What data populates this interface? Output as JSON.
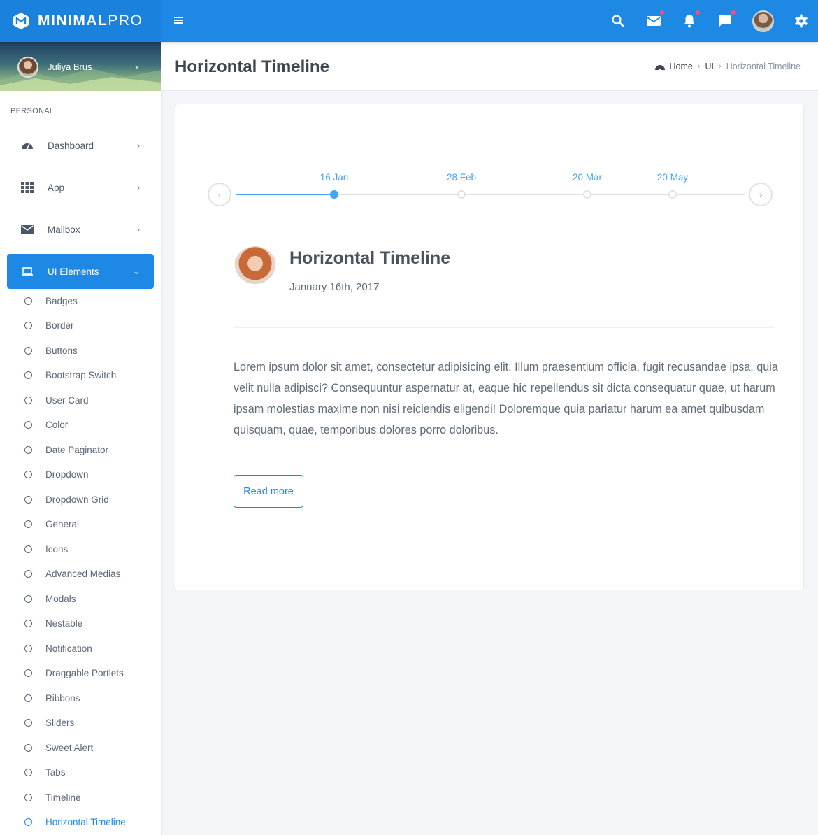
{
  "brand": {
    "name_bold": "MINIMAL",
    "name_light": "PRO"
  },
  "topbar": {
    "icons": [
      "menu-icon",
      "search-icon",
      "mail-icon",
      "bell-icon",
      "chat-icon",
      "avatar",
      "gear-icon"
    ],
    "notification_dot_color": "#ff4d6d",
    "accent": "#1e88e5"
  },
  "sidebar": {
    "user_name": "Juliya Brus",
    "section_label": "PERSONAL",
    "menu": [
      {
        "label": "Dashboard",
        "icon": "dashboard-icon"
      },
      {
        "label": "App",
        "icon": "grid-icon"
      },
      {
        "label": "Mailbox",
        "icon": "envelope-icon"
      },
      {
        "label": "UI Elements",
        "icon": "laptop-icon",
        "active": true
      }
    ],
    "sub_items": [
      "Badges",
      "Border",
      "Buttons",
      "Bootstrap Switch",
      "User Card",
      "Color",
      "Date Paginator",
      "Dropdown",
      "Dropdown Grid",
      "General",
      "Icons",
      "Advanced Medias",
      "Modals",
      "Nestable",
      "Notification",
      "Draggable Portlets",
      "Ribbons",
      "Sliders",
      "Sweet Alert",
      "Tabs",
      "Timeline",
      "Horizontal Timeline"
    ],
    "current_sub_item": "Horizontal Timeline"
  },
  "header": {
    "title": "Horizontal Timeline",
    "breadcrumb": [
      "Home",
      "UI",
      "Horizontal Timeline"
    ]
  },
  "timeline": {
    "dates": [
      "16 Jan",
      "28 Feb",
      "20 Mar",
      "20 May"
    ],
    "selected": "16 Jan"
  },
  "event": {
    "title": "Horizontal Timeline",
    "date": "January 16th, 2017",
    "body": "Lorem ipsum dolor sit amet, consectetur adipisicing elit. Illum praesentium officia, fugit recusandae ipsa, quia velit nulla adipisci? Consequuntur aspernatur at, eaque hic repellendus sit dicta consequatur quae, ut harum ipsam molestias maxime non nisi reiciendis eligendi! Doloremque quia pariatur harum ea amet quibusdam quisquam, quae, temporibus dolores porro doloribus.",
    "button": "Read more"
  }
}
